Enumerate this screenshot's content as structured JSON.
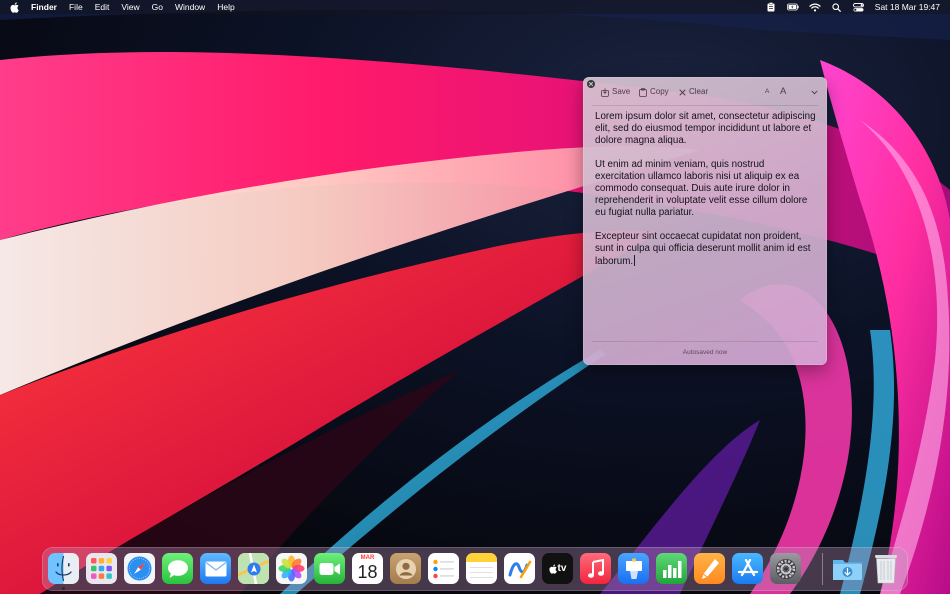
{
  "menubar": {
    "app_name": "Finder",
    "menus": [
      "File",
      "Edit",
      "View",
      "Go",
      "Window",
      "Help"
    ],
    "clock": "Sat 18 Mar  19:47",
    "status_icons": [
      "clipboard-icon",
      "battery-icon",
      "wifi-icon",
      "search-icon",
      "control-center-icon"
    ]
  },
  "note": {
    "toolbar": {
      "save_label": "Save",
      "copy_label": "Copy",
      "clear_label": "Clear",
      "font_small_label": "A",
      "font_large_label": "A"
    },
    "paragraphs": [
      "Lorem ipsum dolor sit amet, consectetur adipiscing elit, sed do eiusmod tempor incididunt ut labore et dolore magna aliqua.",
      "Ut enim ad minim veniam, quis nostrud exercitation ullamco laboris nisi ut aliquip ex ea commodo consequat. Duis aute irure dolor in reprehenderit in voluptate velit esse cillum dolore eu fugiat nulla pariatur.",
      "Excepteur sint occaecat cupidatat non proident, sunt in culpa qui officia deserunt mollit anim id est laborum."
    ],
    "footer": "Autosaved now"
  },
  "dock": {
    "apps": [
      "Finder",
      "Launchpad",
      "Safari",
      "Messages",
      "Mail",
      "Maps",
      "Photos",
      "FaceTime",
      "Calendar",
      "Contacts",
      "Reminders",
      "Notes",
      "Freeform",
      "TV",
      "Music",
      "Keynote",
      "Numbers",
      "Pages",
      "App Store",
      "System Settings",
      "Downloads",
      "Trash"
    ],
    "calendar_month": "MAR",
    "calendar_day": "18",
    "tv_label": "tv"
  }
}
